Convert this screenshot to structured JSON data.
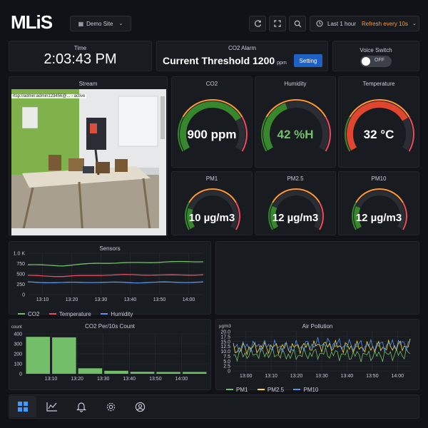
{
  "header": {
    "logo": "MLiS",
    "site_selector": "Demo Site",
    "time_range": "Last 1 hour",
    "refresh": "Refresh every 10s",
    "icons": [
      "refresh-icon",
      "fullscreen-icon",
      "search-icon",
      "clock-icon"
    ]
  },
  "time_panel": {
    "title": "Time",
    "value": "2:03:43 PM"
  },
  "alarm_panel": {
    "title": "CO2 Alarm",
    "label": "Current Threshold 1200",
    "unit": "ppm",
    "button": "Setting"
  },
  "voice_panel": {
    "title": "Voice Switch",
    "toggle": "OFF"
  },
  "stream_panel": {
    "title": "Stream",
    "url_text": "rtsp://admin:admin123456@... - active"
  },
  "gauges": [
    {
      "title": "CO2",
      "value_text": "900 ppm",
      "fraction": 0.75,
      "fill": "#37872d",
      "value_color": "#ffffff"
    },
    {
      "title": "Humidity",
      "value_text": "42 %H",
      "fraction": 0.42,
      "fill": "#37872d",
      "value_color": "#73bf69"
    },
    {
      "title": "Temperature",
      "value_text": "32 °C",
      "fraction": 0.75,
      "fill": "#e0452f",
      "value_color": "#ffffff"
    },
    {
      "title": "PM1",
      "value_text": "10 µg/m3",
      "fraction": 0.2,
      "fill": "#37872d",
      "value_color": "#ffffff"
    },
    {
      "title": "PM2.5",
      "value_text": "12 µg/m3",
      "fraction": 0.22,
      "fill": "#37872d",
      "value_color": "#ffffff"
    },
    {
      "title": "PM10",
      "value_text": "12 µg/m3",
      "fraction": 0.22,
      "fill": "#37872d",
      "value_color": "#ffffff"
    }
  ],
  "chart_data": [
    {
      "type": "line",
      "title": "Sensors",
      "ylim": [
        0,
        1000
      ],
      "yticks": [
        "0",
        "250",
        "500",
        "750",
        "1.0 K"
      ],
      "ytick_values": [
        0,
        250,
        500,
        750,
        1000
      ],
      "x": [
        "13:10",
        "13:20",
        "13:30",
        "13:40",
        "13:50",
        "14:00"
      ],
      "series": [
        {
          "name": "CO2",
          "color": "#73bf69",
          "values": [
            720,
            700,
            760,
            770,
            790,
            800
          ]
        },
        {
          "name": "Temperature",
          "color": "#f2495c",
          "values": [
            460,
            440,
            470,
            480,
            470,
            480
          ]
        },
        {
          "name": "Humidity",
          "color": "#5794f2",
          "values": [
            300,
            290,
            300,
            290,
            300,
            300
          ]
        }
      ]
    },
    {
      "type": "bar",
      "title": "CO2 Per/10s Count",
      "ylabel": "count",
      "ylim": [
        0,
        400
      ],
      "yticks": [
        "0",
        "100",
        "200",
        "300",
        "400"
      ],
      "ytick_values": [
        0,
        100,
        200,
        300,
        400
      ],
      "xticks": [
        "13:10",
        "13:20",
        "13:30",
        "13:40",
        "13:50",
        "14:00"
      ],
      "values": [
        370,
        365,
        55,
        30,
        20,
        18,
        18
      ],
      "color": "#73bf69"
    },
    {
      "type": "line",
      "title": "Air Pollution",
      "ylabel": "µg/m3",
      "ylim": [
        0,
        20
      ],
      "yticks": [
        "0",
        "2.5",
        "5.0",
        "7.5",
        "10.0",
        "12.5",
        "15.0",
        "17.5",
        "20.0"
      ],
      "ytick_values": [
        0,
        2.5,
        5,
        7.5,
        10,
        12.5,
        15,
        17.5,
        20
      ],
      "x": [
        "13:00",
        "13:10",
        "13:20",
        "13:30",
        "13:40",
        "13:50",
        "14:00"
      ],
      "series": [
        {
          "name": "PM1",
          "color": "#73bf69",
          "values": [
            8,
            9,
            8,
            9,
            8,
            8,
            9
          ]
        },
        {
          "name": "PM2.5",
          "color": "#fade2a",
          "values": [
            11,
            12,
            12,
            13,
            12,
            12,
            13
          ]
        },
        {
          "name": "PM10",
          "color": "#5794f2",
          "values": [
            12,
            13,
            12,
            14,
            13,
            13,
            14
          ]
        }
      ]
    }
  ],
  "nav": [
    {
      "name": "dashboard-icon",
      "active": true
    },
    {
      "name": "chart-icon",
      "active": false
    },
    {
      "name": "bell-icon",
      "active": false
    },
    {
      "name": "gear-icon",
      "active": false
    },
    {
      "name": "user-icon",
      "active": false
    }
  ]
}
